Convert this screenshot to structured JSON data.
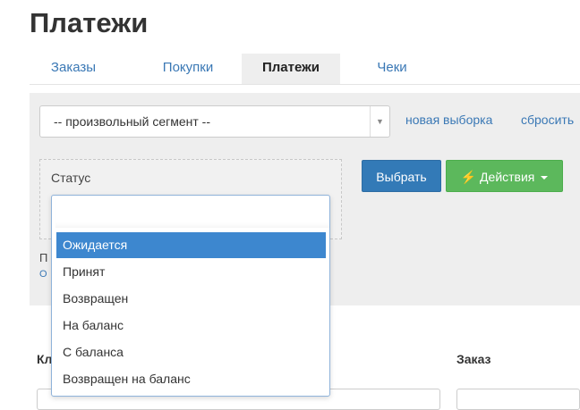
{
  "page": {
    "title": "Платежи"
  },
  "tabs": [
    {
      "label": "Заказы",
      "active": false
    },
    {
      "label": "Покупки",
      "active": false
    },
    {
      "label": "Платежи",
      "active": true
    },
    {
      "label": "Чеки",
      "active": false
    }
  ],
  "filters": {
    "segment": {
      "value": "-- произвольный сегмент --"
    },
    "new_selection_link": "новая выборка",
    "reset_link": "сбросить",
    "status": {
      "label": "Статус",
      "search_value": "",
      "options": [
        "Ожидается",
        "Принят",
        "Возвращен",
        "На баланс",
        "С баланса",
        "Возвращен на баланс"
      ],
      "highlighted_index": 0
    },
    "select_button": "Выбрать",
    "actions_button": "Действия",
    "partial_label_1": "П",
    "partial_label_2": "О"
  },
  "table": {
    "partial_header_client": "Кл",
    "header_order": "Заказ"
  },
  "colors": {
    "accent_link": "#3a78b5",
    "primary_button": "#337ab7",
    "success_button": "#5cb85c",
    "highlight": "#3d87cf"
  }
}
